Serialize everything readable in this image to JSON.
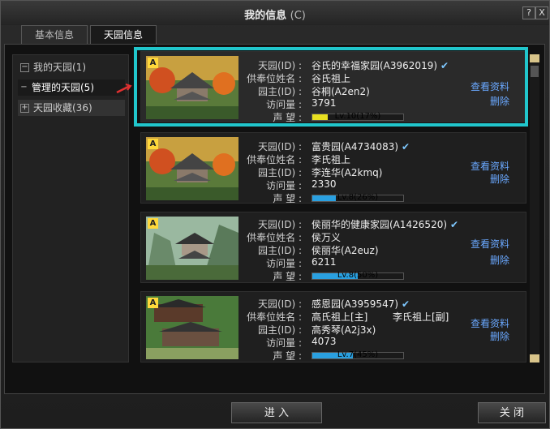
{
  "window": {
    "title": "我的信息",
    "hotkey": "(C)",
    "help_label": "?",
    "close_label": "X"
  },
  "tabs": [
    {
      "label": "基本信息"
    },
    {
      "label": "天园信息"
    }
  ],
  "tree": [
    {
      "sign": "−",
      "label": "我的天园(1)"
    },
    {
      "sign": "−",
      "label": "管理的天园(5)"
    },
    {
      "sign": "+",
      "label": "天园收藏(36)"
    }
  ],
  "field_labels": {
    "garden": "天园(ID) :",
    "shrine": "供奉位姓名 :",
    "owner": "园主(ID) :",
    "visits": "访问量 :",
    "fame": "声  望 :"
  },
  "gardens": [
    {
      "badge": "A",
      "garden": "谷氏的幸福家园(A3962019)",
      "shrine": "谷氏祖上",
      "shrine2": "",
      "owner": "谷桐(A2en2)",
      "visits": "3791",
      "fame": "Lv.10(17%)",
      "fame_pct": 17,
      "bar_color": "#e8e020",
      "view": "查看资料",
      "delete": "删除"
    },
    {
      "badge": "A",
      "garden": "富贵园(A4734083)",
      "shrine": "李氏祖上",
      "shrine2": "",
      "owner": "李连华(A2kmq)",
      "visits": "2330",
      "fame": "Lv.8(26%)",
      "fame_pct": 26,
      "bar_color": "#2aa0e0",
      "view": "查看资料",
      "delete": "删除"
    },
    {
      "badge": "A",
      "garden": "侯丽华的健康家园(A1426520)",
      "shrine": "侯万义",
      "shrine2": "",
      "owner": "侯丽华(A2euz)",
      "visits": "6211",
      "fame": "Lv.8(50%)",
      "fame_pct": 50,
      "bar_color": "#2aa0e0",
      "view": "查看资料",
      "delete": "删除"
    },
    {
      "badge": "A",
      "garden": "感恩园(A3959547)",
      "shrine": "高氏祖上[主]",
      "shrine2": "李氏祖上[副]",
      "owner": "高秀琴(A2j3x)",
      "visits": "4073",
      "fame": "Lv.7(45%)",
      "fame_pct": 45,
      "bar_color": "#2aa0e0",
      "view": "查看资料",
      "delete": "删除"
    }
  ],
  "buttons": {
    "enter": "进 入",
    "close": "关 闭"
  }
}
